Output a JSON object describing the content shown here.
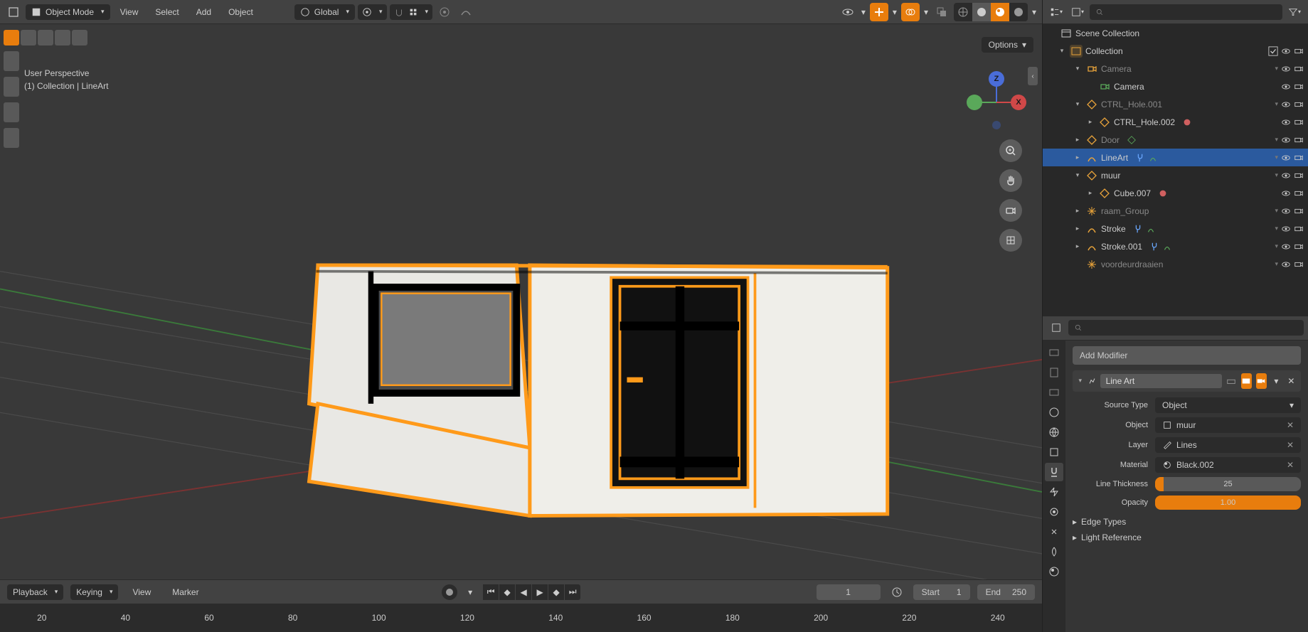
{
  "header": {
    "mode": "Object Mode",
    "menus": [
      "View",
      "Select",
      "Add",
      "Object"
    ],
    "transform_orientation": "Global",
    "options_label": "Options"
  },
  "viewport": {
    "perspective": "User Perspective",
    "context": "(1) Collection | LineArt"
  },
  "outliner": {
    "root": "Scene Collection",
    "collection": "Collection",
    "items": [
      {
        "name": "Camera",
        "icon": "camera",
        "depth": 2,
        "disclosure": "▾",
        "dim": true
      },
      {
        "name": "Camera",
        "icon": "camera-data",
        "depth": 3,
        "disclosure": "",
        "dim": false
      },
      {
        "name": "CTRL_Hole.001",
        "icon": "mesh",
        "depth": 2,
        "disclosure": "▾",
        "dim": true
      },
      {
        "name": "CTRL_Hole.002",
        "icon": "mesh",
        "depth": 3,
        "disclosure": "▸",
        "dim": false
      },
      {
        "name": "Door",
        "icon": "mesh",
        "depth": 2,
        "disclosure": "▸",
        "dim": true
      },
      {
        "name": "LineArt",
        "icon": "gpencil",
        "depth": 2,
        "disclosure": "▸",
        "selected": true
      },
      {
        "name": "muur",
        "icon": "mesh",
        "depth": 2,
        "disclosure": "▾",
        "dim": false
      },
      {
        "name": "Cube.007",
        "icon": "mesh",
        "depth": 3,
        "disclosure": "▸",
        "dim": false
      },
      {
        "name": "raam_Group",
        "icon": "empty",
        "depth": 2,
        "disclosure": "▸",
        "dim": true
      },
      {
        "name": "Stroke",
        "icon": "gpencil",
        "depth": 2,
        "disclosure": "▸",
        "dim": false
      },
      {
        "name": "Stroke.001",
        "icon": "gpencil",
        "depth": 2,
        "disclosure": "▸",
        "dim": false
      },
      {
        "name": "voordeurdraaien",
        "icon": "empty",
        "depth": 2,
        "disclosure": "",
        "dim": true
      }
    ]
  },
  "properties": {
    "add_modifier": "Add Modifier",
    "modifier_name": "Line Art",
    "rows": [
      {
        "label": "Source Type",
        "value": "Object",
        "type": "dropdown"
      },
      {
        "label": "Object",
        "value": "muur",
        "type": "picker"
      },
      {
        "label": "Layer",
        "value": "Lines",
        "type": "picker"
      },
      {
        "label": "Material",
        "value": "Black.002",
        "type": "picker"
      },
      {
        "label": "Line Thickness",
        "value": "25",
        "type": "slider",
        "fill": 0.06
      },
      {
        "label": "Opacity",
        "value": "1.00",
        "type": "slider",
        "fill": 1.0
      }
    ],
    "sections": [
      "Edge Types",
      "Light Reference"
    ]
  },
  "timeline": {
    "playback": "Playback",
    "keying": "Keying",
    "menus": [
      "View",
      "Marker"
    ],
    "current_frame": "1",
    "start_label": "Start",
    "start": "1",
    "end_label": "End",
    "end": "250",
    "ticks": [
      "20",
      "40",
      "60",
      "80",
      "100",
      "120",
      "140",
      "160",
      "180",
      "200",
      "220",
      "240"
    ]
  }
}
